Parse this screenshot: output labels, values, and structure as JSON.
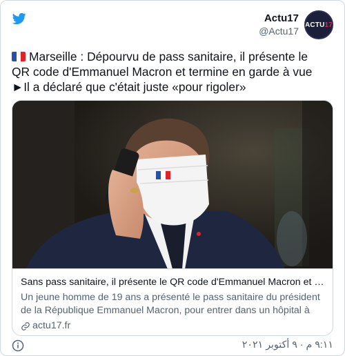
{
  "colors": {
    "twitter_blue": "#1d9bf0",
    "text": "#0f1419",
    "secondary": "#536471",
    "border": "#cfd9de"
  },
  "author": {
    "name": "Actu17",
    "handle": "@Actu17",
    "avatar_text_main": "ACTU",
    "avatar_text_accent": "17"
  },
  "tweet": {
    "line1": "Marseille : Dépourvu de pass sanitaire, il présente le",
    "line2": "QR code d'Emmanuel Macron et termine en garde à vue",
    "line3": "►Il a déclaré que c'était juste «pour rigoler»",
    "flag_icon": "france-flag"
  },
  "card": {
    "title": "Sans pass sanitaire, il présente le QR code d'Emmanuel Macron et termi...",
    "description": "Un jeune homme de 19 ans a présenté le pass sanitaire du président de la République Emmanuel Macron, pour entrer dans un hôpital à Marseille c...",
    "domain": "actu17.fr",
    "image_description_icon": "photo-man-with-mask-on-phone"
  },
  "footer": {
    "timestamp": "٩:١١ م · ٩ أكتوبر ٢٠٢١",
    "info_icon": "info-icon"
  }
}
